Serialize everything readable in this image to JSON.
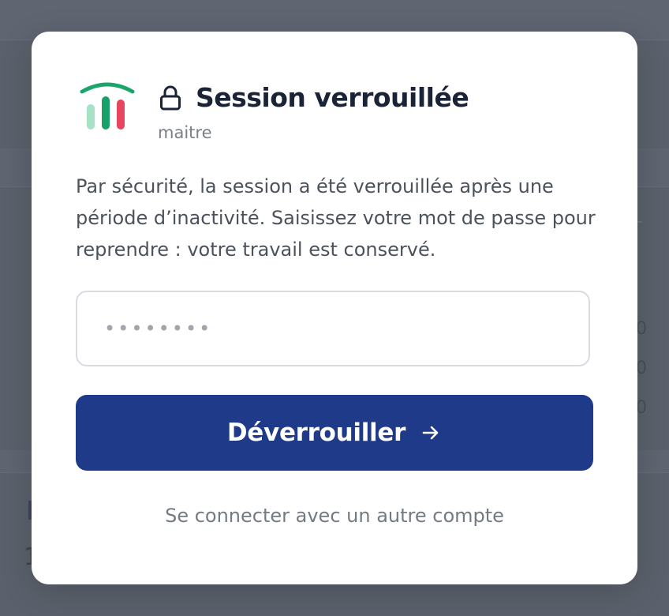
{
  "background": {
    "row_values": [
      "0",
      "0",
      "0"
    ],
    "fragment": "1"
  },
  "lock_dialog": {
    "title": "Session verrouillée",
    "username": "maitre",
    "message": "Par sécurité, la session a été verrouillée après une période d’inactivité. Saisissez votre mot de passe pour reprendre : votre travail est conservé.",
    "password_value": "••••••••",
    "unlock_label": "Déverrouiller",
    "switch_account_label": "Se connecter avec un autre compte"
  },
  "icons": {
    "logo": "bar-chart-logo-icon",
    "lock": "lock-icon",
    "arrow": "arrow-right-icon"
  },
  "colors": {
    "primary_button": "#1f3a89",
    "logo_arc": "#1aa56b",
    "logo_bar_light": "#a7e2c6",
    "logo_bar_mid": "#17a068",
    "logo_bar_accent": "#e8455f",
    "title_text": "#1b2436"
  }
}
